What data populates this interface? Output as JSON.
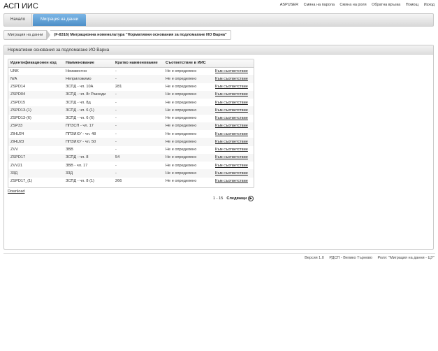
{
  "app": {
    "title": "АСП ИИС"
  },
  "top_links": [
    "ASPUSER",
    "Смяна на парола",
    "Смяна на роля",
    "Обратна връзка",
    "Помощ",
    "Изход"
  ],
  "nav": {
    "home": "Начало",
    "migration": "Миграция на данни"
  },
  "breadcrumb": {
    "first": "Миграция на данни",
    "current": "(F-8316) Миграционна номенклатура \"Нормативни основания за подломагане ИО Варна\""
  },
  "panel": {
    "title": "Нормативни основания за подломагане ИО Варна"
  },
  "table": {
    "headers": [
      "Идентификационен код",
      "Наименование",
      "Кратко наименование",
      "Съответствие в ИИС",
      ""
    ],
    "rows": [
      [
        "UNK",
        "Неизвестно",
        "-",
        "Не е определено",
        "Към съответствие"
      ],
      [
        "N/A",
        "Неприложимо",
        "-",
        "Не е определено",
        "Към съответствие"
      ],
      [
        "ZSPD14",
        "ЗСПД - чл. 10А",
        "281",
        "Не е определено",
        "Към съответствие"
      ],
      [
        "ZSPD04",
        "ЗСПД - чл. 8г Разходи",
        "-",
        "Не е определено",
        "Към съответствие"
      ],
      [
        "ZSPD15",
        "ЗСПД - чл. 8д",
        "-",
        "Не е определено",
        "Към съответствие"
      ],
      [
        "ZSPD13-(1)",
        "ЗСПД - чл. 6 (1)",
        "-",
        "Не е определено",
        "Към съответствие"
      ],
      [
        "ZSPD13-(6)",
        "ЗСПД - чл. 6 (6)",
        "-",
        "Не е определено",
        "Към съответствие"
      ],
      [
        "ZSP33",
        "ППЗСП - чл. 17",
        "-",
        "Не е определено",
        "Към съответствие"
      ],
      [
        "ZIHU24",
        "ППЗИХУ - чл. 48",
        "-",
        "Не е определено",
        "Към съответствие"
      ],
      [
        "ZIHU23",
        "ППЗИХУ - чл. 50",
        "-",
        "Не е определено",
        "Към съответствие"
      ],
      [
        "ZVV",
        "ЗВВ",
        "-",
        "Не е определено",
        "Към съответствие"
      ],
      [
        "ZSPD17",
        "ЗСПД - чл. 8",
        "54",
        "Не е определено",
        "Към съответствие"
      ],
      [
        "ZVV21",
        "ЗВВ - чл. 17",
        "-",
        "Не е определено",
        "Към съответствие"
      ],
      [
        "33Д",
        "33Д",
        "-",
        "Не е определено",
        "Към съответствие"
      ],
      [
        "ZSPD17_(1)",
        "ЗСПД - чл. 8 (1)",
        "266",
        "Не е определено",
        "Към съответствие"
      ]
    ]
  },
  "download_label": "Download",
  "pager": {
    "range": "1 - 15",
    "next": "Следващи",
    "next_icon": "arrow-right-circle"
  },
  "footer": [
    "Версия 1.0",
    "РДСП - Велико Търново",
    "Роля: \"Миграция на данни - ЦУ\""
  ]
}
